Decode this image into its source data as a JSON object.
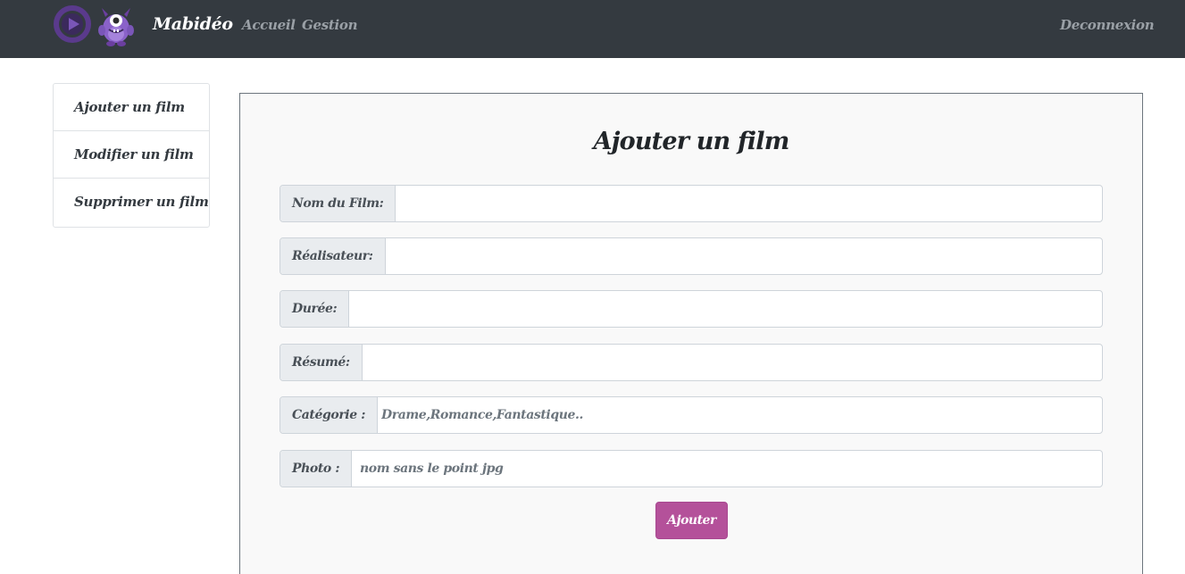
{
  "navbar": {
    "brand": "Mabidéo",
    "links": [
      "Accueil",
      "Gestion"
    ],
    "logout": "Deconnexion",
    "logo_icons": [
      "play-circle-icon",
      "purple-monster-icon"
    ]
  },
  "sidebar": {
    "items": [
      {
        "label": "Ajouter un film"
      },
      {
        "label": "Modifier un film"
      },
      {
        "label": "Supprimer un film"
      }
    ]
  },
  "form": {
    "title": "Ajouter un film",
    "fields": [
      {
        "label": "Nom du Film:",
        "value": "",
        "placeholder": ""
      },
      {
        "label": "Réalisateur:",
        "value": "",
        "placeholder": ""
      },
      {
        "label": "Durée:",
        "value": "",
        "placeholder": ""
      },
      {
        "label": "Résumé:",
        "value": "",
        "placeholder": ""
      },
      {
        "label": "Catégorie :",
        "value": "",
        "placeholder": "Drame,Romance,Fantastique.."
      },
      {
        "label": "Photo :",
        "value": "",
        "placeholder": "nom sans le point jpg"
      }
    ],
    "submit_label": "Ajouter"
  },
  "colors": {
    "navbar_bg": "#343a40",
    "accent": "#b4519a",
    "logo_purple": "#6b3fa0"
  }
}
